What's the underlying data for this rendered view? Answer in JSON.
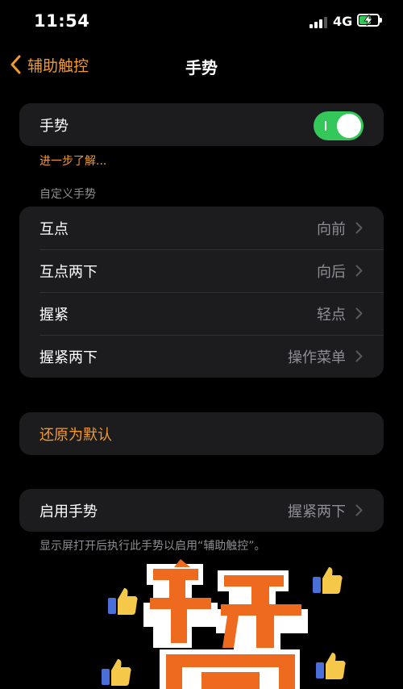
{
  "status_bar": {
    "time": "11:54",
    "network": "4G"
  },
  "nav": {
    "back_label": "辅助触控",
    "title": "手势"
  },
  "gesture_toggle": {
    "label": "手势",
    "on": true
  },
  "learn_more": "进一步了解...",
  "custom_section": {
    "header": "自定义手势",
    "rows": [
      {
        "label": "互点",
        "value": "向前"
      },
      {
        "label": "互点两下",
        "value": "向后"
      },
      {
        "label": "握紧",
        "value": "轻点"
      },
      {
        "label": "握紧两下",
        "value": "操作菜单"
      }
    ]
  },
  "restore_defaults": "还原为默认",
  "enable_gesture": {
    "label": "启用手势",
    "value": "握紧两下"
  },
  "footer_note": "显示屏打开后执行此手势以启用“辅助触控”。",
  "colors": {
    "accent": "#f39a2c",
    "toggle_on": "#34c759",
    "cell_bg": "#1c1c1e",
    "secondary_text": "#8e8e93"
  },
  "sticker": {
    "icons": [
      "thumbs-up-icon",
      "thumbs-up-icon",
      "thumbs-up-icon",
      "thumbs-up-icon"
    ]
  }
}
